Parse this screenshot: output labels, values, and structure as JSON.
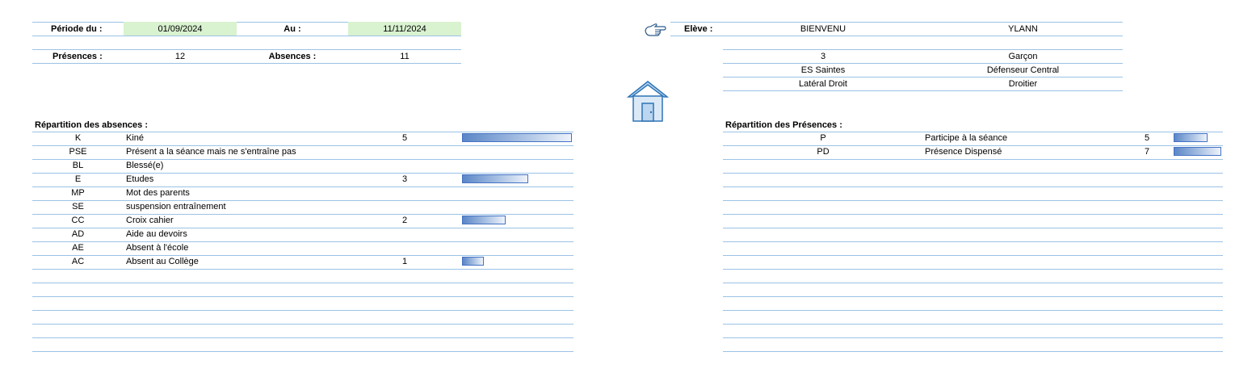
{
  "period": {
    "from_label": "Période du :",
    "from_value": "01/09/2024",
    "to_label": "Au :",
    "to_value": "11/11/2024"
  },
  "totals": {
    "presences_label": "Présences :",
    "presences_value": "12",
    "absences_label": "Absences :",
    "absences_value": "11"
  },
  "student": {
    "label": "Elève :",
    "last_name": "BIENVENU",
    "first_name": "YLANN",
    "number": "3",
    "gender": "Garçon",
    "club": "ES Saintes",
    "position": "Défenseur Central",
    "secondary_position": "Latéral Droit",
    "foot": "Droitier"
  },
  "absences": {
    "title": "Répartition des absences :",
    "rows": [
      {
        "code": "K",
        "label": "Kiné",
        "count": "5"
      },
      {
        "code": "PSE",
        "label": "Présent a la séance mais ne s'entraîne pas",
        "count": ""
      },
      {
        "code": "BL",
        "label": "Blessé(e)",
        "count": ""
      },
      {
        "code": "E",
        "label": "Etudes",
        "count": "3"
      },
      {
        "code": "MP",
        "label": "Mot des parents",
        "count": ""
      },
      {
        "code": "SE",
        "label": "suspension entraînement",
        "count": ""
      },
      {
        "code": "CC",
        "label": "Croix cahier",
        "count": "2"
      },
      {
        "code": "AD",
        "label": "Aide au devoirs",
        "count": ""
      },
      {
        "code": "AE",
        "label": "Absent à l'école",
        "count": ""
      },
      {
        "code": "AC",
        "label": "Absent au Collège",
        "count": "1"
      }
    ]
  },
  "presences": {
    "title": "Répartition des Présences :",
    "rows": [
      {
        "code": "P",
        "label": "Participe à la séance",
        "count": "5"
      },
      {
        "code": "PD",
        "label": "Présence Dispensé",
        "count": "7"
      }
    ]
  },
  "icons": {
    "pointer": "pointing-hand-icon",
    "home": "house-icon"
  },
  "colors": {
    "grid_line": "#9bc2e6",
    "date_fill": "#d9f2d0",
    "bar": "#4472c4"
  }
}
